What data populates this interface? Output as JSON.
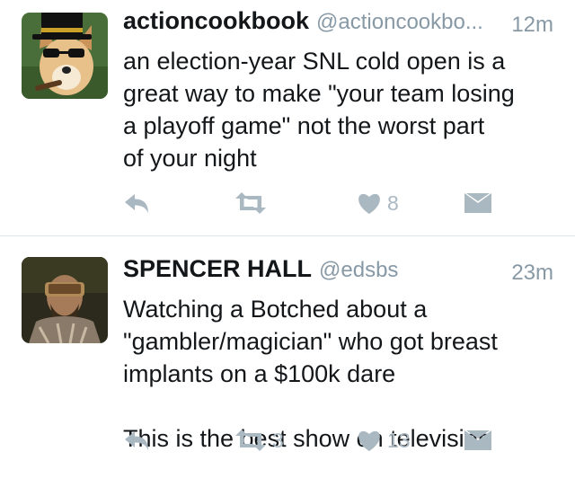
{
  "colors": {
    "text": "#14171a",
    "muted": "#8899a6",
    "icon": "#aab8c2",
    "divider": "#e1e8ed"
  },
  "tweets": [
    {
      "display_name": "actioncookbook",
      "handle": "@actioncookbo...",
      "time": "12m",
      "avatar_icon": "dog-with-top-hat-avatar",
      "text": "an election-year SNL cold open is a\ngreat way to make \"your team losing\na playoff game\" not the worst part\nof your night",
      "retweets": "",
      "likes": "8"
    },
    {
      "display_name": "SPENCER HALL",
      "handle": "@edsbs",
      "time": "23m",
      "avatar_icon": "man-with-vr-headset-avatar",
      "text": "Watching a Botched about a\n\"gambler/magician\" who got breast\nimplants on a $100k dare\n\nThis is the best show on television",
      "retweets": "3",
      "likes": "13"
    }
  ],
  "action_icons": [
    "reply-icon",
    "retweet-icon",
    "heart-icon",
    "direct-message-icon"
  ]
}
